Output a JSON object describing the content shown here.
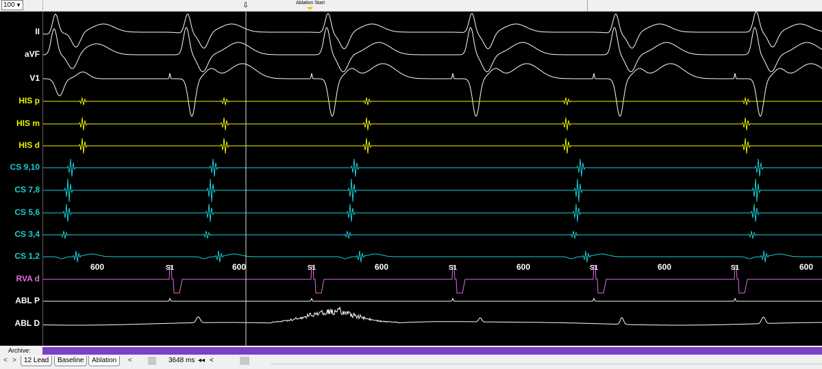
{
  "toolbar": {
    "zoom_value": "100",
    "marker_label": "Ablation Start"
  },
  "colors": {
    "surface": "#ffffff",
    "his": "#f0f000",
    "cs": "#17d0d8",
    "rva": "#e06ce0",
    "cursor": "#dcdcdc"
  },
  "channels": [
    {
      "name": "II",
      "color": "#ffffff"
    },
    {
      "name": "aVF",
      "color": "#ffffff"
    },
    {
      "name": "V1",
      "color": "#ffffff"
    },
    {
      "name": "HIS p",
      "color": "#f0f000"
    },
    {
      "name": "HIS m",
      "color": "#f0f000"
    },
    {
      "name": "HIS d",
      "color": "#f0f000"
    },
    {
      "name": "CS 9,10",
      "color": "#17d0d8"
    },
    {
      "name": "CS 7,8",
      "color": "#17d0d8"
    },
    {
      "name": "CS 5,6",
      "color": "#17d0d8"
    },
    {
      "name": "CS 3,4",
      "color": "#17d0d8"
    },
    {
      "name": "CS 1,2",
      "color": "#17d0d8"
    },
    {
      "name": "RVA d",
      "color": "#e06ce0"
    },
    {
      "name": "ABL P",
      "color": "#ffffff"
    },
    {
      "name": "ABL D",
      "color": "#ffffff"
    }
  ],
  "pacing": {
    "stim_label": "S1",
    "interval_labels": [
      "600",
      "600",
      "600",
      "600",
      "600",
      "600"
    ],
    "stim_count": 5
  },
  "archive": {
    "label": "Archive:"
  },
  "tabs": [
    {
      "label": "12 Lead"
    },
    {
      "label": "Baseline"
    },
    {
      "label": "Ablation"
    }
  ],
  "footer": {
    "duration": "3648 ms",
    "nav_prev": "<",
    "nav_next": ">",
    "nav_fast_back": "◂◂",
    "nav_back": "<"
  }
}
